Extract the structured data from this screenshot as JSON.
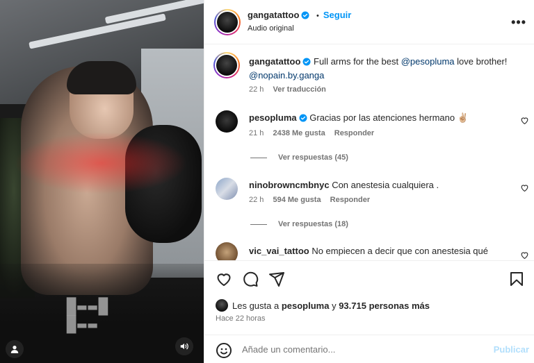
{
  "header": {
    "username": "gangatattoo",
    "follow_label": "Seguir",
    "audio_label": "Audio original",
    "separator": "•",
    "more_label": "•••"
  },
  "caption": {
    "username": "gangatattoo",
    "text_before": "Full arms for the best ",
    "mention1": "@pesopluma",
    "text_after": " love brother!",
    "mention2": "@nopain.by.ganga",
    "time": "22 h",
    "translate_label": "Ver traducción"
  },
  "comments": [
    {
      "username": "pesopluma",
      "verified": true,
      "text": "Gracias por las atenciones hermano",
      "emoji": "✌🏼",
      "time": "21 h",
      "likes": "2438 Me gusta",
      "reply_label": "Responder",
      "view_replies": "Ver respuestas (45)"
    },
    {
      "username": "ninobrowncmbnyc",
      "verified": false,
      "text": "Con anestesia cualquiera .",
      "time": "22 h",
      "likes": "594 Me gusta",
      "reply_label": "Responder",
      "view_replies": "Ver respuestas (18)"
    },
    {
      "username": "vic_vai_tattoo",
      "verified": false,
      "text": "No empiecen a decir que con anestesia qué",
      "time": "",
      "likes": "",
      "reply_label": ""
    }
  ],
  "likes_line": {
    "prefix": "Les gusta a ",
    "user": "pesopluma",
    "middle": " y ",
    "count": "93.715 personas más"
  },
  "time_ago": "Hace 22 horas",
  "add_comment": {
    "placeholder": "Añade un comentario...",
    "publish_label": "Publicar"
  },
  "media_overlay_text": [
    "█▬▬█",
    "█▬▬"
  ],
  "colors": {
    "accent": "#0095f6",
    "verified": "#0095f6",
    "mention": "#00376b",
    "muted": "#737373",
    "publish_disabled": "#b2dffc"
  },
  "icons": [
    "user-tag-icon",
    "speaker-icon",
    "heart-icon",
    "comment-icon",
    "share-icon",
    "bookmark-icon",
    "emoji-icon",
    "more-icon",
    "verified-icon"
  ]
}
